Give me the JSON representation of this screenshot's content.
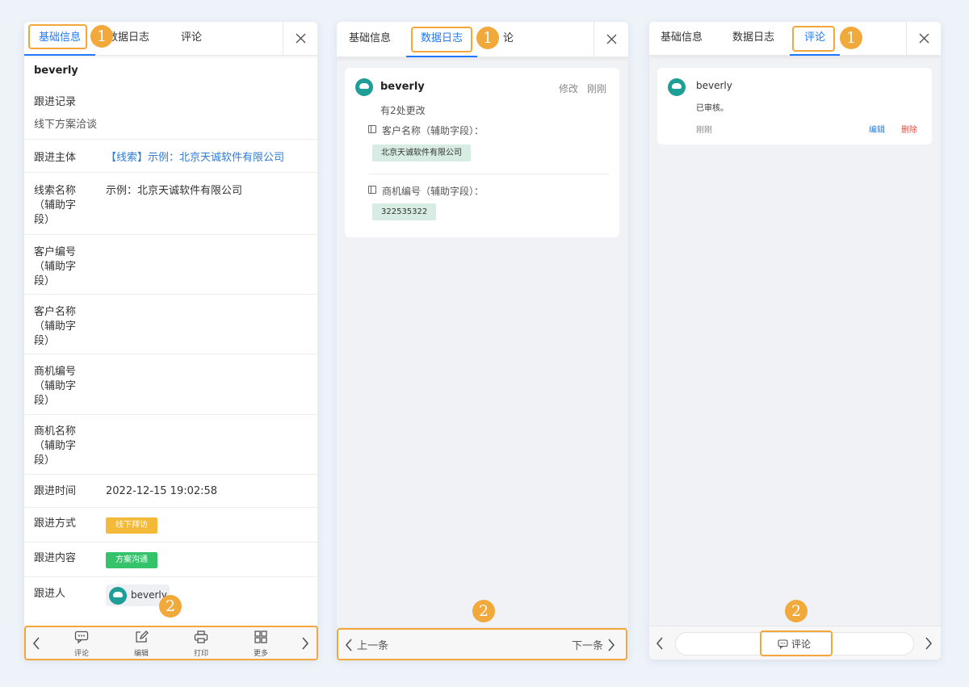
{
  "panel1": {
    "tabs": [
      "基础信息",
      "数据日志",
      "评论"
    ],
    "user": "beverly",
    "record_label": "跟进记录",
    "record_value": "线下方案洽谈",
    "rows": [
      {
        "label": "跟进主体",
        "value": "【线索】示例：北京天诚软件有限公司"
      },
      {
        "label": "线索名称\n（辅助字\n段）",
        "value": "示例：北京天诚软件有限公司"
      },
      {
        "label": "客户编号\n（辅助字\n段）",
        "value": ""
      },
      {
        "label": "客户名称\n（辅助字\n段）",
        "value": ""
      },
      {
        "label": "商机编号\n（辅助字\n段）",
        "value": ""
      },
      {
        "label": "商机名称\n（辅助字\n段）",
        "value": ""
      },
      {
        "label": "跟进时间",
        "value": "2022-12-15 19:02:58"
      },
      {
        "label": "跟进方式",
        "value": "线下拜访"
      },
      {
        "label": "跟进内容",
        "value": "方案沟通"
      },
      {
        "label": "跟进人",
        "value": "beverly"
      }
    ],
    "toolbar": [
      "评论",
      "编辑",
      "打印",
      "更多"
    ]
  },
  "panel2": {
    "tabs": [
      "基础信息",
      "数据日志",
      "论"
    ],
    "user": "beverly",
    "edit": "修改",
    "time": "刚刚",
    "summary": "有2处更改",
    "changes": [
      {
        "field": "客户名称（辅助字段）：",
        "value": "北京天诚软件有限公司"
      },
      {
        "field": "商机编号（辅助字段）：",
        "value": "322535322"
      }
    ],
    "prev": "上一条",
    "next": "下一条"
  },
  "panel3": {
    "tabs": [
      "基础信息",
      "数据日志",
      "评论"
    ],
    "user": "beverly",
    "comment": "已审核。",
    "time": "刚刚",
    "edit": "编辑",
    "delete": "删除",
    "comment_button": "评论"
  },
  "badges": {
    "one": "1",
    "two": "2"
  },
  "colors": {
    "accent": "#1f78ff",
    "highlight": "#f3a73b",
    "tag_yellow": "#f5b93a",
    "tag_green": "#34c26b",
    "delete": "#e8493f"
  }
}
